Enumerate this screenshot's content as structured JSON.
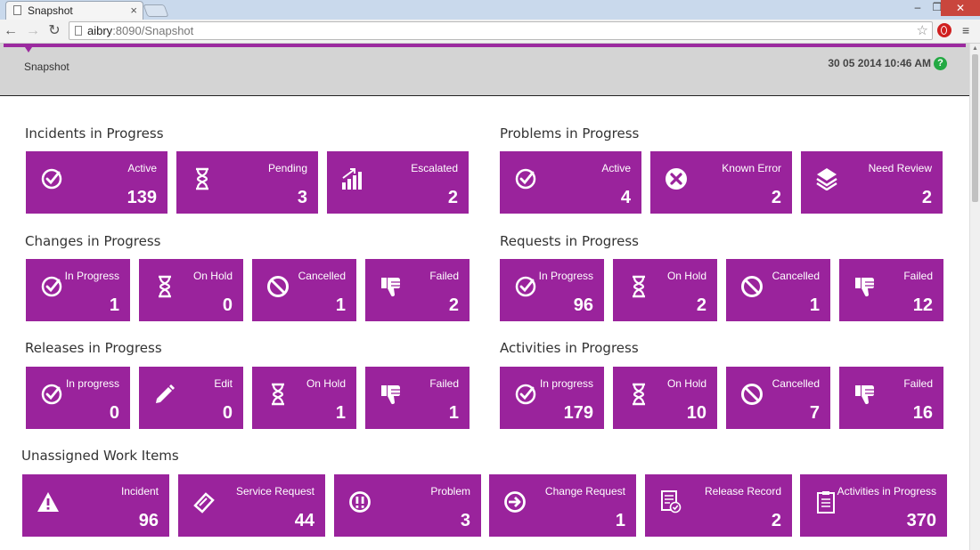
{
  "browser": {
    "tab_title": "Snapshot",
    "url_host": "aibry",
    "url_rest": ":8090/Snapshot"
  },
  "header": {
    "page_title": "Snapshot",
    "timestamp": "30 05 2014 10:46 AM",
    "help": "?"
  },
  "incidents": {
    "title": "Incidents in Progress",
    "tiles": [
      {
        "label": "Active",
        "count": "139",
        "icon": "check-circle-icon"
      },
      {
        "label": "Pending",
        "count": "3",
        "icon": "hourglass-icon"
      },
      {
        "label": "Escalated",
        "count": "2",
        "icon": "bar-chart-icon"
      }
    ]
  },
  "problems": {
    "title": "Problems in Progress",
    "tiles": [
      {
        "label": "Active",
        "count": "4",
        "icon": "check-circle-icon"
      },
      {
        "label": "Known Error",
        "count": "2",
        "icon": "x-circle-icon"
      },
      {
        "label": "Need Review",
        "count": "2",
        "icon": "layers-icon"
      }
    ]
  },
  "changes": {
    "title": "Changes in Progress",
    "tiles": [
      {
        "label": "In Progress",
        "count": "1",
        "icon": "check-circle-icon"
      },
      {
        "label": "On Hold",
        "count": "0",
        "icon": "hourglass-icon"
      },
      {
        "label": "Cancelled",
        "count": "1",
        "icon": "ban-icon"
      },
      {
        "label": "Failed",
        "count": "2",
        "icon": "thumbs-down-icon"
      }
    ]
  },
  "requests": {
    "title": "Requests in Progress",
    "tiles": [
      {
        "label": "In Progress",
        "count": "96",
        "icon": "check-circle-icon"
      },
      {
        "label": "On Hold",
        "count": "2",
        "icon": "hourglass-icon"
      },
      {
        "label": "Cancelled",
        "count": "1",
        "icon": "ban-icon"
      },
      {
        "label": "Failed",
        "count": "12",
        "icon": "thumbs-down-icon"
      }
    ]
  },
  "releases": {
    "title": "Releases in Progress",
    "tiles": [
      {
        "label": "In progress",
        "count": "0",
        "icon": "check-circle-icon"
      },
      {
        "label": "Edit",
        "count": "0",
        "icon": "pencil-icon"
      },
      {
        "label": "On Hold",
        "count": "1",
        "icon": "hourglass-icon"
      },
      {
        "label": "Failed",
        "count": "1",
        "icon": "thumbs-down-icon"
      }
    ]
  },
  "activities": {
    "title": "Activities in Progress",
    "tiles": [
      {
        "label": "In progress",
        "count": "179",
        "icon": "check-circle-icon"
      },
      {
        "label": "On Hold",
        "count": "10",
        "icon": "hourglass-icon"
      },
      {
        "label": "Cancelled",
        "count": "7",
        "icon": "ban-icon"
      },
      {
        "label": "Failed",
        "count": "16",
        "icon": "thumbs-down-icon"
      }
    ]
  },
  "unassigned": {
    "title": "Unassigned Work Items",
    "tiles": [
      {
        "label": "Incident",
        "count": "96",
        "icon": "warning-icon"
      },
      {
        "label": "Service Request",
        "count": "44",
        "icon": "ticket-icon"
      },
      {
        "label": "Problem",
        "count": "3",
        "icon": "exclamation-circle-icon"
      },
      {
        "label": "Change Request",
        "count": "1",
        "icon": "arrow-circle-icon"
      },
      {
        "label": "Release Record",
        "count": "2",
        "icon": "document-check-icon"
      },
      {
        "label": "Activities in Progress",
        "count": "370",
        "icon": "clipboard-icon"
      }
    ]
  },
  "colors": {
    "tile": "#9a239c",
    "accent": "#9b2a9f",
    "help": "#24a944"
  }
}
